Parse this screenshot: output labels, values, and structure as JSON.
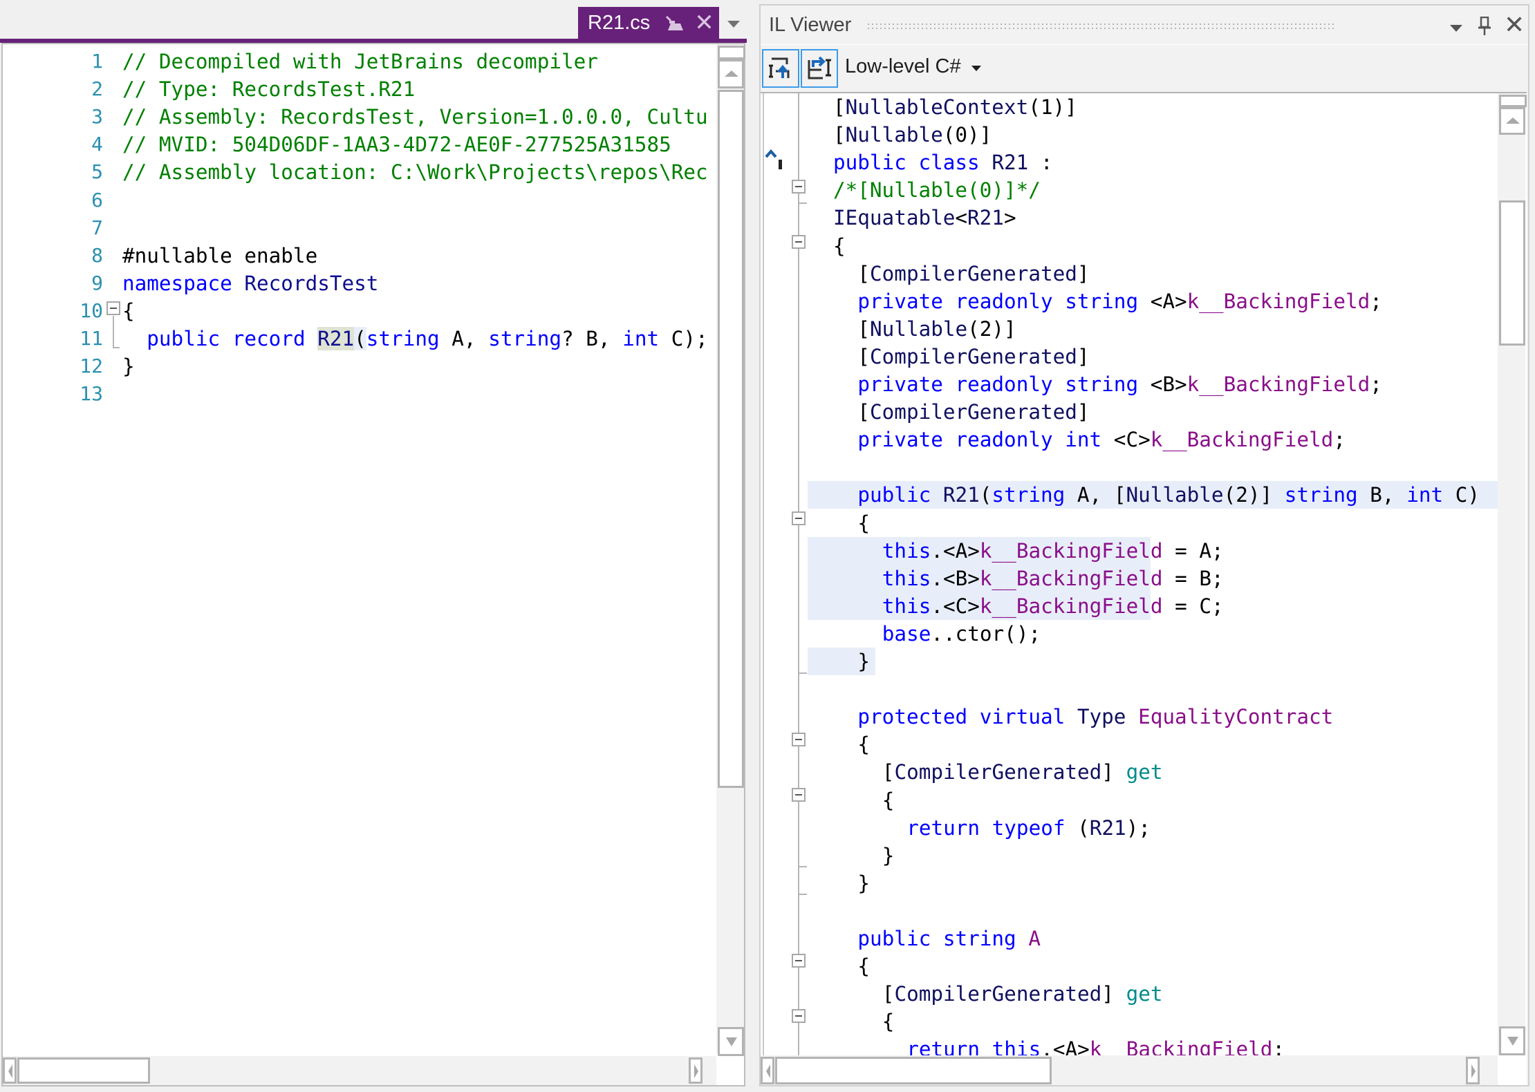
{
  "document_tab": {
    "title": "R21.cs",
    "pin_icon": "pin-tab-icon",
    "close_icon": "close-icon",
    "accent_color": "#68217A"
  },
  "left_editor": {
    "lines": [
      {
        "num": "1",
        "tokens": [
          {
            "t": "// Decompiled with JetBrains decompiler",
            "c": "cm"
          }
        ]
      },
      {
        "num": "2",
        "tokens": [
          {
            "t": "// Type: RecordsTest.R21",
            "c": "cm"
          }
        ]
      },
      {
        "num": "3",
        "tokens": [
          {
            "t": "// Assembly: RecordsTest, Version=1.0.0.0, Cultu",
            "c": "cm"
          }
        ]
      },
      {
        "num": "4",
        "tokens": [
          {
            "t": "// MVID: 504D06DF-1AA3-4D72-AE0F-277525A31585",
            "c": "cm"
          }
        ]
      },
      {
        "num": "5",
        "tokens": [
          {
            "t": "// Assembly location: C:\\Work\\Projects\\repos\\Rec",
            "c": "cm"
          }
        ]
      },
      {
        "num": "6",
        "tokens": []
      },
      {
        "num": "7",
        "tokens": []
      },
      {
        "num": "8",
        "tokens": [
          {
            "t": "#nullable enable",
            "c": "pl"
          }
        ]
      },
      {
        "num": "9",
        "tokens": [
          {
            "t": "namespace ",
            "c": "kw"
          },
          {
            "t": "RecordsTest",
            "c": "ty"
          }
        ]
      },
      {
        "num": "10",
        "tokens": [
          {
            "t": "{",
            "c": "pl"
          }
        ]
      },
      {
        "num": "11",
        "tokens": [
          {
            "t": "  public ",
            "c": "kw"
          },
          {
            "t": "record ",
            "c": "kw"
          },
          {
            "t": "R21",
            "c": "ty hl-word"
          },
          {
            "t": "(",
            "c": "pl hl-par"
          },
          {
            "t": "string",
            "c": "kw"
          },
          {
            "t": " A, ",
            "c": "pl"
          },
          {
            "t": "string",
            "c": "kw"
          },
          {
            "t": "? B, ",
            "c": "pl"
          },
          {
            "t": "int",
            "c": "kw"
          },
          {
            "t": " C);",
            "c": "pl"
          }
        ]
      },
      {
        "num": "12",
        "tokens": [
          {
            "t": "}",
            "c": "pl"
          }
        ]
      },
      {
        "num": "13",
        "tokens": []
      }
    ]
  },
  "il_viewer": {
    "title": "IL Viewer",
    "toolbar": {
      "sync_from_editor_icon": "sync-to-il-icon",
      "sync_to_editor_icon": "sync-from-il-icon",
      "mode_selected": "Low-level C#"
    },
    "lines": [
      {
        "i": 0,
        "tokens": [
          {
            "t": "[",
            "c": "pl"
          },
          {
            "t": "NullableContext",
            "c": "ty2"
          },
          {
            "t": "(1)]",
            "c": "pl"
          }
        ]
      },
      {
        "i": 0,
        "tokens": [
          {
            "t": "[",
            "c": "pl"
          },
          {
            "t": "Nullable",
            "c": "ty2"
          },
          {
            "t": "(0)]",
            "c": "pl"
          }
        ]
      },
      {
        "i": 0,
        "tokens": [
          {
            "t": "public ",
            "c": "kw"
          },
          {
            "t": "class ",
            "c": "kw"
          },
          {
            "t": "R21",
            "c": "ty2"
          },
          {
            "t": " :",
            "c": "pl"
          }
        ]
      },
      {
        "i": 0,
        "tokens": [
          {
            "t": "/*[Nullable(0)]*/",
            "c": "cm"
          }
        ]
      },
      {
        "i": 0,
        "tokens": [
          {
            "t": "IEquatable",
            "c": "ty2"
          },
          {
            "t": "<",
            "c": "pl"
          },
          {
            "t": "R21",
            "c": "ty2"
          },
          {
            "t": ">",
            "c": "pl"
          }
        ]
      },
      {
        "i": 0,
        "tokens": [
          {
            "t": "{",
            "c": "pl"
          }
        ]
      },
      {
        "i": 1,
        "tokens": [
          {
            "t": "[",
            "c": "pl"
          },
          {
            "t": "CompilerGenerated",
            "c": "ty2"
          },
          {
            "t": "]",
            "c": "pl"
          }
        ]
      },
      {
        "i": 1,
        "tokens": [
          {
            "t": "private ",
            "c": "kw"
          },
          {
            "t": "readonly ",
            "c": "kw"
          },
          {
            "t": "string",
            "c": "kw"
          },
          {
            "t": " <A>",
            "c": "pl"
          },
          {
            "t": "k__BackingField",
            "c": "mb"
          },
          {
            "t": ";",
            "c": "pl"
          }
        ]
      },
      {
        "i": 1,
        "tokens": [
          {
            "t": "[",
            "c": "pl"
          },
          {
            "t": "Nullable",
            "c": "ty2"
          },
          {
            "t": "(2)]",
            "c": "pl"
          }
        ]
      },
      {
        "i": 1,
        "tokens": [
          {
            "t": "[",
            "c": "pl"
          },
          {
            "t": "CompilerGenerated",
            "c": "ty2"
          },
          {
            "t": "]",
            "c": "pl"
          }
        ]
      },
      {
        "i": 1,
        "tokens": [
          {
            "t": "private ",
            "c": "kw"
          },
          {
            "t": "readonly ",
            "c": "kw"
          },
          {
            "t": "string",
            "c": "kw"
          },
          {
            "t": " <B>",
            "c": "pl"
          },
          {
            "t": "k__BackingField",
            "c": "mb"
          },
          {
            "t": ";",
            "c": "pl"
          }
        ]
      },
      {
        "i": 1,
        "tokens": [
          {
            "t": "[",
            "c": "pl"
          },
          {
            "t": "CompilerGenerated",
            "c": "ty2"
          },
          {
            "t": "]",
            "c": "pl"
          }
        ]
      },
      {
        "i": 1,
        "tokens": [
          {
            "t": "private ",
            "c": "kw"
          },
          {
            "t": "readonly ",
            "c": "kw"
          },
          {
            "t": "int",
            "c": "kw"
          },
          {
            "t": " <C>",
            "c": "pl"
          },
          {
            "t": "k__BackingField",
            "c": "mb"
          },
          {
            "t": ";",
            "c": "pl"
          }
        ]
      },
      {
        "i": 1,
        "tokens": []
      },
      {
        "i": 1,
        "hl": "full",
        "tokens": [
          {
            "t": "public ",
            "c": "kw"
          },
          {
            "t": "R21",
            "c": "ty2"
          },
          {
            "t": "(",
            "c": "pl"
          },
          {
            "t": "string",
            "c": "kw"
          },
          {
            "t": " A, [",
            "c": "pl"
          },
          {
            "t": "Nullable",
            "c": "ty2"
          },
          {
            "t": "(2)] ",
            "c": "pl"
          },
          {
            "t": "string",
            "c": "kw"
          },
          {
            "t": " B, ",
            "c": "pl"
          },
          {
            "t": "int",
            "c": "kw"
          },
          {
            "t": " C)",
            "c": "pl"
          }
        ]
      },
      {
        "i": 1,
        "tokens": [
          {
            "t": "{",
            "c": "pl"
          }
        ]
      },
      {
        "i": 2,
        "hl": "assign",
        "tokens": [
          {
            "t": "this",
            "c": "kw"
          },
          {
            "t": ".<A>",
            "c": "pl"
          },
          {
            "t": "k__BackingField",
            "c": "mb"
          },
          {
            "t": " = A;",
            "c": "pl"
          }
        ]
      },
      {
        "i": 2,
        "hl": "assign",
        "tokens": [
          {
            "t": "this",
            "c": "kw"
          },
          {
            "t": ".<B>",
            "c": "pl"
          },
          {
            "t": "k__BackingField",
            "c": "mb"
          },
          {
            "t": " = B;",
            "c": "pl"
          }
        ]
      },
      {
        "i": 2,
        "hl": "assign",
        "tokens": [
          {
            "t": "this",
            "c": "kw"
          },
          {
            "t": ".<C>",
            "c": "pl"
          },
          {
            "t": "k__BackingField",
            "c": "mb"
          },
          {
            "t": " = C;",
            "c": "pl"
          }
        ]
      },
      {
        "i": 2,
        "tokens": [
          {
            "t": "base",
            "c": "kw"
          },
          {
            "t": "..ctor();",
            "c": "pl"
          }
        ]
      },
      {
        "i": 1,
        "hl": "brace",
        "tokens": [
          {
            "t": "}",
            "c": "pl"
          }
        ]
      },
      {
        "i": 1,
        "tokens": []
      },
      {
        "i": 1,
        "tokens": [
          {
            "t": "protected ",
            "c": "kw"
          },
          {
            "t": "virtual ",
            "c": "kw"
          },
          {
            "t": "Type",
            "c": "ty2"
          },
          {
            "t": " ",
            "c": "pl"
          },
          {
            "t": "EqualityContract",
            "c": "mb"
          }
        ]
      },
      {
        "i": 1,
        "tokens": [
          {
            "t": "{",
            "c": "pl"
          }
        ]
      },
      {
        "i": 2,
        "tokens": [
          {
            "t": "[",
            "c": "pl"
          },
          {
            "t": "CompilerGenerated",
            "c": "ty2"
          },
          {
            "t": "] ",
            "c": "pl"
          },
          {
            "t": "get",
            "c": "acc"
          }
        ]
      },
      {
        "i": 2,
        "tokens": [
          {
            "t": "{",
            "c": "pl"
          }
        ]
      },
      {
        "i": 3,
        "tokens": [
          {
            "t": "return ",
            "c": "kw"
          },
          {
            "t": "typeof",
            "c": "kw"
          },
          {
            "t": " (",
            "c": "pl"
          },
          {
            "t": "R21",
            "c": "ty2"
          },
          {
            "t": ");",
            "c": "pl"
          }
        ]
      },
      {
        "i": 2,
        "tokens": [
          {
            "t": "}",
            "c": "pl"
          }
        ]
      },
      {
        "i": 1,
        "tokens": [
          {
            "t": "}",
            "c": "pl"
          }
        ]
      },
      {
        "i": 1,
        "tokens": []
      },
      {
        "i": 1,
        "tokens": [
          {
            "t": "public ",
            "c": "kw"
          },
          {
            "t": "string",
            "c": "kw"
          },
          {
            "t": " ",
            "c": "pl"
          },
          {
            "t": "A",
            "c": "mb"
          }
        ]
      },
      {
        "i": 1,
        "tokens": [
          {
            "t": "{",
            "c": "pl"
          }
        ]
      },
      {
        "i": 2,
        "tokens": [
          {
            "t": "[",
            "c": "pl"
          },
          {
            "t": "CompilerGenerated",
            "c": "ty2"
          },
          {
            "t": "] ",
            "c": "pl"
          },
          {
            "t": "get",
            "c": "acc"
          }
        ]
      },
      {
        "i": 2,
        "tokens": [
          {
            "t": "{",
            "c": "pl"
          }
        ]
      },
      {
        "i": 3,
        "tokens": [
          {
            "t": "return ",
            "c": "kw"
          },
          {
            "t": "this",
            "c": "kw"
          },
          {
            "t": ".<A>",
            "c": "pl"
          },
          {
            "t": "k__BackingField",
            "c": "mb"
          },
          {
            "t": ";",
            "c": "pl"
          }
        ]
      }
    ]
  }
}
